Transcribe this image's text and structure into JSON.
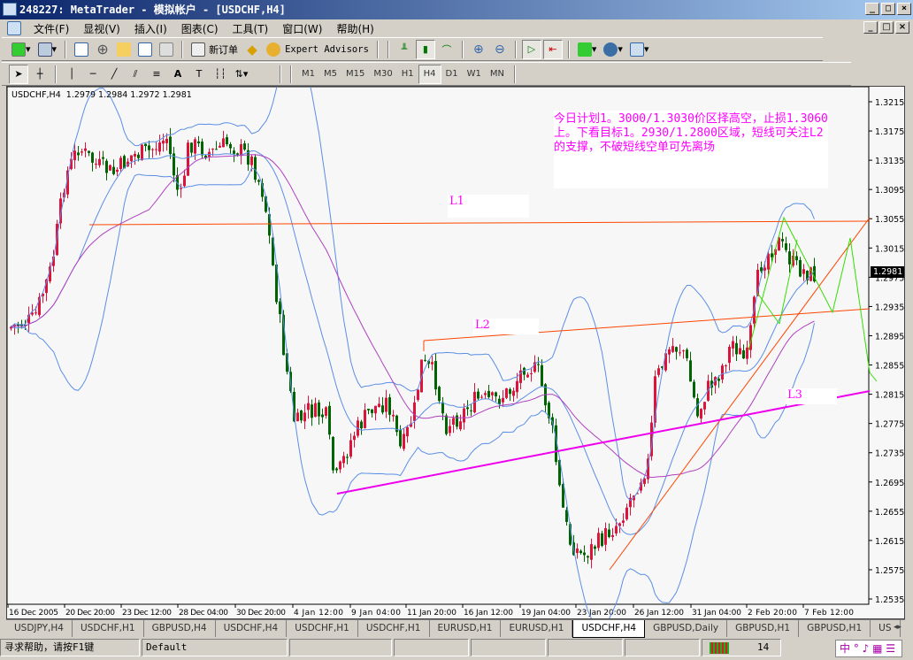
{
  "window": {
    "title": "248227: MetaTrader - 模拟帐户 - [USDCHF,H4]",
    "minimize": "_",
    "maximize": "□",
    "close": "×"
  },
  "menu": [
    "文件(F)",
    "显视(V)",
    "插入(I)",
    "图表(C)",
    "工具(T)",
    "窗口(W)",
    "帮助(H)"
  ],
  "toolbar": {
    "new_order": "新订单",
    "expert_advisors": "Expert Advisors"
  },
  "timeframes": [
    "M1",
    "M5",
    "M15",
    "M30",
    "H1",
    "H4",
    "D1",
    "W1",
    "MN"
  ],
  "active_timeframe": "H4",
  "chart": {
    "header": "USDCHF,H4  1.2979 1.2984 1.2972 1.2981",
    "current_price": "1.2981",
    "price_axis": [
      "1.3215",
      "1.3175",
      "1.3135",
      "1.3095",
      "1.3055",
      "1.3015",
      "1.2975",
      "1.2935",
      "1.2895",
      "1.2855",
      "1.2815",
      "1.2775",
      "1.2735",
      "1.2695",
      "1.2655",
      "1.2615",
      "1.2575",
      "1.2535"
    ],
    "time_axis": [
      "16 Dec 2005",
      "20 Dec 20:00",
      "23 Dec 12:00",
      "28 Dec 04:00",
      "30 Dec 20:00",
      "4 Jan 12:00",
      "9 Jan 04:00",
      "11 Jan 20:00",
      "16 Jan 12:00",
      "19 Jan 04:00",
      "23 Jan 20:00",
      "26 Jan 12:00",
      "31 Jan 04:00",
      "2 Feb 20:00",
      "7 Feb 12:00"
    ],
    "annotation": "今日计划1。3000/1.3030价区择高空，止损1.3060上。下看目标1。2930/1.2800区域，短线可关注L2的支撑，不破短线空单可先离场",
    "labels": {
      "l1": "L1",
      "l2": "L2",
      "l3": "L3"
    },
    "colors": {
      "bull": "#dc143c",
      "bear": "#006400",
      "bands": "#5b8ee6",
      "ma": "#b040c0",
      "trend": "#ff4500",
      "support": "#ee00ee",
      "projection": "#33dd00",
      "annotation": "#ff00ff"
    }
  },
  "tabs": [
    {
      "label": "USDJPY,H4"
    },
    {
      "label": "USDCHF,H1"
    },
    {
      "label": "GBPUSD,H4"
    },
    {
      "label": "USDCHF,H4"
    },
    {
      "label": "USDCHF,H1"
    },
    {
      "label": "USDCHF,H1"
    },
    {
      "label": "EURUSD,H1"
    },
    {
      "label": "EURUSD,H1"
    },
    {
      "label": "USDCHF,H4",
      "active": true
    },
    {
      "label": "GBPUSD,Daily"
    },
    {
      "label": "GBPUSD,H1"
    },
    {
      "label": "GBPUSD,H1"
    },
    {
      "label": "US"
    }
  ],
  "status": {
    "help": "寻求帮助，请按F1键",
    "profile": "Default",
    "traffic": "14"
  }
}
